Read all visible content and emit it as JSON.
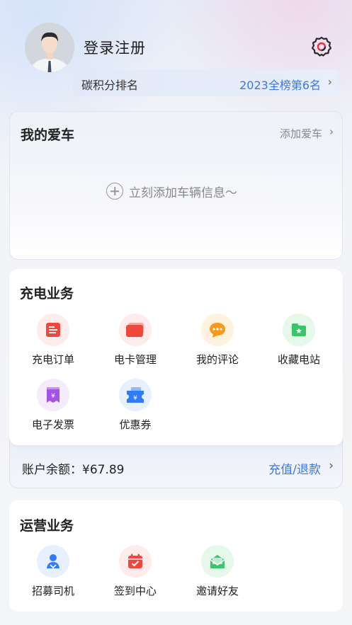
{
  "header": {
    "username": "登录注册",
    "rank_label": "碳积分排名",
    "rank_value": "2023全榜第6名",
    "chevron": "›"
  },
  "my_car": {
    "title": "我的爱车",
    "add_link": "添加爱车",
    "empty_text": "立刻添加车辆信息～",
    "chevron": "›"
  },
  "charging_service": {
    "title": "充电业务",
    "items": [
      {
        "label": "充电订单",
        "icon": "charge-order-icon",
        "bg": "#fdeceb",
        "color": "#f0473c"
      },
      {
        "label": "电卡管理",
        "icon": "card-management-icon",
        "bg": "#fdeceb",
        "color": "#f0473c"
      },
      {
        "label": "我的评论",
        "icon": "comment-icon",
        "bg": "#fff3e0",
        "color": "#f59a1b"
      },
      {
        "label": "收藏电站",
        "icon": "favorite-station-icon",
        "bg": "#e6f8ea",
        "color": "#3cc46a"
      },
      {
        "label": "电子发票",
        "icon": "invoice-icon",
        "bg": "#f4ebfb",
        "color": "#a254e6"
      },
      {
        "label": "优惠券",
        "icon": "coupon-icon",
        "bg": "#e7f0fd",
        "color": "#2f7cf6"
      }
    ]
  },
  "balance": {
    "label": "账户余额：¥67.89",
    "action": "充值/退款",
    "chevron": "›"
  },
  "operations": {
    "title": "运营业务",
    "items": [
      {
        "label": "招募司机",
        "icon": "recruit-driver-icon",
        "bg": "#e7f0fd",
        "color": "#2f7cf6"
      },
      {
        "label": "签到中心",
        "icon": "checkin-calendar-icon",
        "bg": "#fdeceb",
        "color": "#f0473c"
      },
      {
        "label": "邀请好友",
        "icon": "invite-friend-icon",
        "bg": "#e6f8ea",
        "color": "#3cc46a"
      }
    ]
  }
}
